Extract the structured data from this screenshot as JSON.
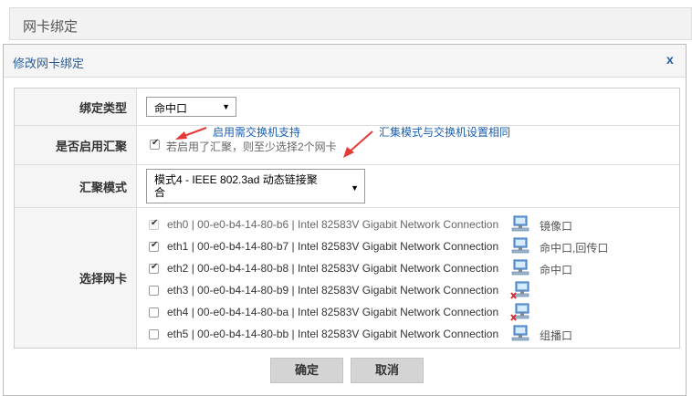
{
  "page": {
    "title": "网卡绑定"
  },
  "modal": {
    "title": "修改网卡绑定",
    "close_label": "x",
    "bind_type": {
      "label": "绑定类型",
      "selected": "命中口"
    },
    "aggregation": {
      "label": "是否启用汇聚",
      "checked": true,
      "hint": "若启用了汇聚，则至少选择2个网卡"
    },
    "annotations": {
      "left": "启用需交换机支持",
      "right": "汇集模式与交换机设置相同"
    },
    "agg_mode": {
      "label": "汇聚模式",
      "selected_line1": "模式4 - IEEE 802.3ad 动态链接聚",
      "selected_line2": "合"
    },
    "nic_select": {
      "label": "选择网卡",
      "nics": [
        {
          "text": "eth0 | 00-e0-b4-14-80-b6 | Intel 82583V Gigabit Network Connection",
          "checked": true,
          "disabled": true,
          "status_icon": "network-connected-icon",
          "role": "镜像口"
        },
        {
          "text": "eth1 | 00-e0-b4-14-80-b7 | Intel 82583V Gigabit Network Connection",
          "checked": true,
          "disabled": false,
          "status_icon": "network-connected-icon",
          "role": "命中口,回传口"
        },
        {
          "text": "eth2 | 00-e0-b4-14-80-b8 | Intel 82583V Gigabit Network Connection",
          "checked": true,
          "disabled": false,
          "status_icon": "network-connected-icon",
          "role": "命中口"
        },
        {
          "text": "eth3 | 00-e0-b4-14-80-b9 | Intel 82583V Gigabit Network Connection",
          "checked": false,
          "disabled": false,
          "status_icon": "network-disconnected-icon",
          "role": ""
        },
        {
          "text": "eth4 | 00-e0-b4-14-80-ba | Intel 82583V Gigabit Network Connection",
          "checked": false,
          "disabled": false,
          "status_icon": "network-disconnected-icon",
          "role": ""
        },
        {
          "text": "eth5 | 00-e0-b4-14-80-bb | Intel 82583V Gigabit Network Connection",
          "checked": false,
          "disabled": false,
          "status_icon": "network-connected-icon",
          "role": "组播口"
        }
      ]
    },
    "buttons": {
      "ok": "确定",
      "cancel": "取消"
    }
  },
  "colors": {
    "accent": "#2a5c9a",
    "annotation": "#1a5fb4",
    "arrow": "#e53935"
  }
}
